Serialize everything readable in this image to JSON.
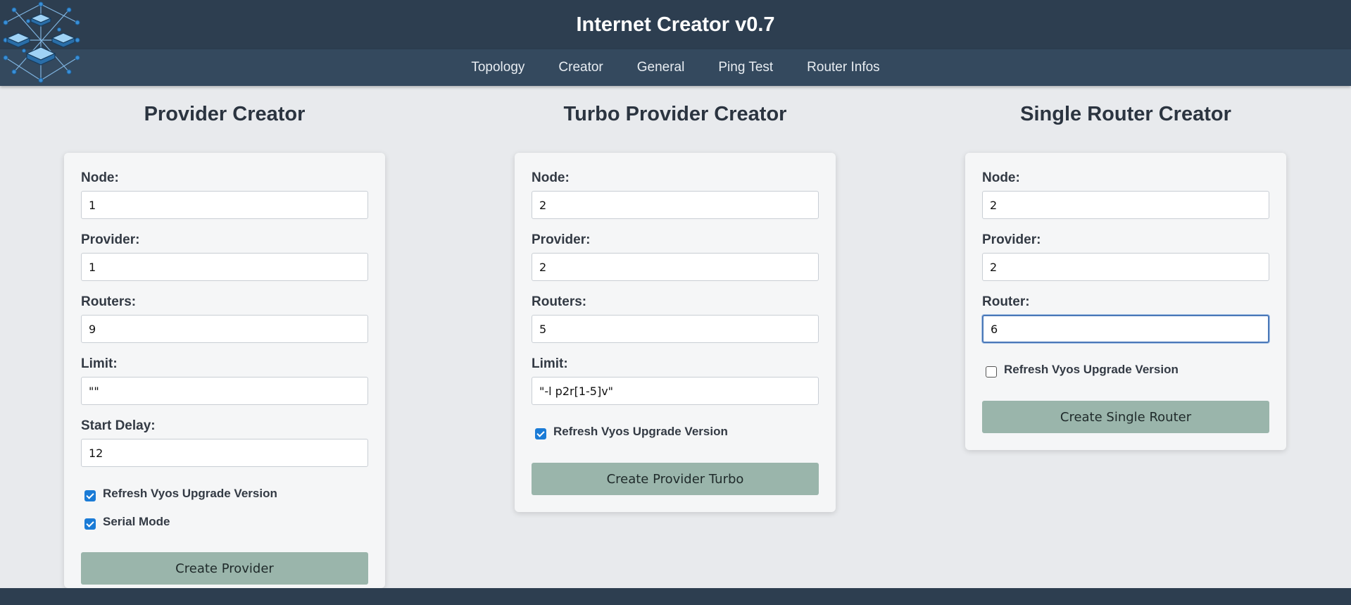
{
  "app": {
    "title": "Internet Creator v0.7"
  },
  "nav": {
    "items": [
      {
        "label": "Topology"
      },
      {
        "label": "Creator"
      },
      {
        "label": "General"
      },
      {
        "label": "Ping Test"
      },
      {
        "label": "Router Infos"
      }
    ]
  },
  "provider_creator": {
    "title": "Provider Creator",
    "fields": [
      {
        "label": "Node:",
        "value": "1"
      },
      {
        "label": "Provider:",
        "value": "1"
      },
      {
        "label": "Routers:",
        "value": "9"
      },
      {
        "label": "Limit:",
        "value": "\"\""
      },
      {
        "label": "Start Delay:",
        "value": "12"
      }
    ],
    "checkboxes": [
      {
        "label": "Refresh Vyos Upgrade Version",
        "checked": true
      },
      {
        "label": "Serial Mode",
        "checked": true
      }
    ],
    "button": "Create Provider"
  },
  "turbo_provider_creator": {
    "title": "Turbo Provider Creator",
    "fields": [
      {
        "label": "Node:",
        "value": "2"
      },
      {
        "label": "Provider:",
        "value": "2"
      },
      {
        "label": "Routers:",
        "value": "5"
      },
      {
        "label": "Limit:",
        "value": "\"-l p2r[1-5]v\""
      }
    ],
    "checkboxes": [
      {
        "label": "Refresh Vyos Upgrade Version",
        "checked": true
      }
    ],
    "button": "Create Provider Turbo"
  },
  "single_router_creator": {
    "title": "Single Router Creator",
    "fields": [
      {
        "label": "Node:",
        "value": "2"
      },
      {
        "label": "Provider:",
        "value": "2"
      },
      {
        "label": "Router:",
        "value": "6"
      }
    ],
    "checkboxes": [
      {
        "label": "Refresh Vyos Upgrade Version",
        "checked": false
      }
    ],
    "button": "Create Single Router"
  },
  "colors": {
    "header": "#2d3e50",
    "navbar": "#34495e",
    "page_background": "#e8eaed",
    "button": "#9ab5ab",
    "checkbox_checked": "#1a7bd6",
    "focus_border": "#4a78b8"
  },
  "icons": {
    "logo": "network-routers-logo-icon"
  }
}
